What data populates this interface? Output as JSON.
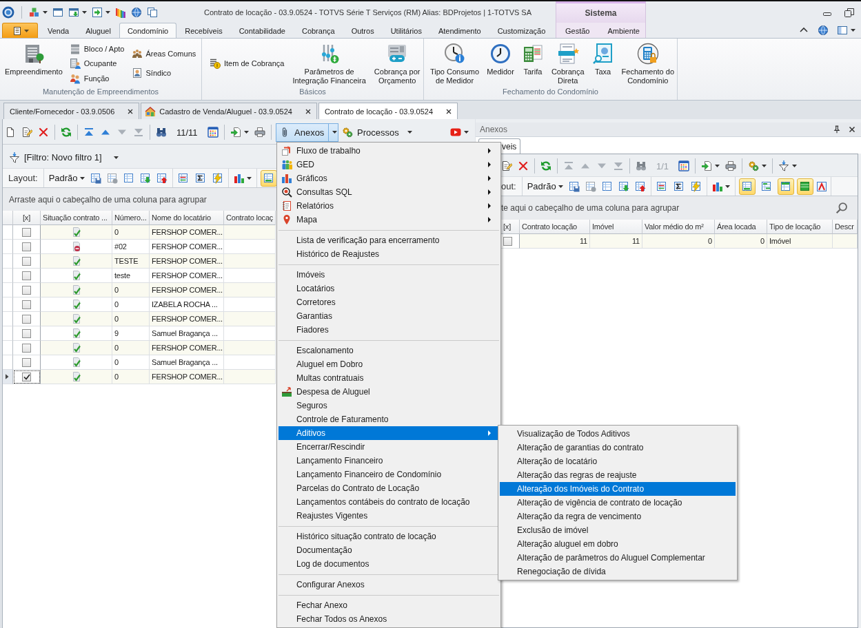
{
  "window": {
    "title": "Contrato de locação - 03.9.0524 - TOTVS Série T Serviços (RM) Alias: BDProjetos | 1-TOTVS SA"
  },
  "ribbon_tabs": [
    {
      "label": "Venda",
      "selected": false
    },
    {
      "label": "Aluguel",
      "selected": false
    },
    {
      "label": "Condomínio",
      "selected": true
    },
    {
      "label": "Recebíveis",
      "selected": false
    },
    {
      "label": "Contabilidade",
      "selected": false
    },
    {
      "label": "Cobrança",
      "selected": false
    },
    {
      "label": "Outros",
      "selected": false
    },
    {
      "label": "Utilitários",
      "selected": false
    },
    {
      "label": "Atendimento",
      "selected": false
    },
    {
      "label": "Customização",
      "selected": false
    }
  ],
  "context_tab_group": {
    "title": "Sistema",
    "tabs": [
      {
        "label": "Gestão",
        "selected": false
      },
      {
        "label": "Ambiente",
        "selected": false
      }
    ]
  },
  "ribbon_groups": [
    {
      "label": "Manutenção de Empreendimentos",
      "columns": [
        {
          "kind": "large",
          "lines": [
            "Empreendimento"
          ]
        },
        {
          "kind": "stack",
          "items": [
            "Bloco / Apto",
            "Ocupante",
            "Função"
          ]
        },
        {
          "kind": "stack",
          "items": [
            "Áreas Comuns",
            "Síndico"
          ]
        }
      ]
    },
    {
      "label": "Básicos",
      "columns": [
        {
          "kind": "stack",
          "items": [
            "Item de Cobrança"
          ]
        },
        {
          "kind": "large",
          "lines": [
            "Parâmetros de",
            "Integração Financeira"
          ]
        },
        {
          "kind": "large",
          "lines": [
            "Cobrança por",
            "Orçamento"
          ]
        }
      ]
    },
    {
      "label": "Fechamento do Condomínio",
      "columns": [
        {
          "kind": "large",
          "lines": [
            "Tipo Consumo",
            "de Medidor"
          ]
        },
        {
          "kind": "large",
          "lines": [
            "Medidor"
          ]
        },
        {
          "kind": "large",
          "lines": [
            "Tarifa"
          ]
        },
        {
          "kind": "large",
          "lines": [
            "Cobrança",
            "Direta"
          ]
        },
        {
          "kind": "large",
          "lines": [
            "Taxa"
          ]
        },
        {
          "kind": "large",
          "lines": [
            "Fechamento do",
            "Condomínio"
          ]
        }
      ]
    }
  ],
  "document_tabs": [
    {
      "label": "Cliente/Fornecedor - 03.9.0506",
      "selected": false
    },
    {
      "label": "Cadastro de Venda/Aluguel - 03.9.0524",
      "selected": false
    },
    {
      "label": "Contrato de locação - 03.9.0524",
      "selected": true
    }
  ],
  "toolbar": {
    "nav_buttons": [
      {
        "disabled": false
      },
      {
        "disabled": false
      },
      {
        "disabled": true
      },
      {
        "disabled": true
      }
    ],
    "record_counter": "11/11",
    "counter_disabled": false,
    "menu_buttons": [
      {
        "label": "Anexos",
        "pressed": true
      },
      {
        "label": "Processos",
        "pressed": false
      }
    ]
  },
  "filter": {
    "label": "[Filtro: Novo filtro 1]"
  },
  "layout_bar": {
    "label": "Layout:",
    "preset": "Padrão",
    "view_toggles": [
      {
        "on": true
      }
    ]
  },
  "group_panel": {
    "hint": "Arraste aqui o cabeçalho de uma coluna para agrupar"
  },
  "table": {
    "check_column": "[x]",
    "columns": [
      "Situação contrato ...",
      "Número...",
      "Nome do locatário",
      "Contrato locaç"
    ],
    "rows": [
      {
        "current": false,
        "checked": false,
        "blocked": false,
        "number": "0",
        "tenant": "FERSHOP COMER..."
      },
      {
        "current": false,
        "checked": false,
        "blocked": true,
        "number": "#02",
        "tenant": "FERSHOP COMER..."
      },
      {
        "current": false,
        "checked": false,
        "blocked": false,
        "number": "TESTE",
        "tenant": "FERSHOP COMER..."
      },
      {
        "current": false,
        "checked": false,
        "blocked": false,
        "number": "teste",
        "tenant": "FERSHOP COMER..."
      },
      {
        "current": false,
        "checked": false,
        "blocked": false,
        "number": "0",
        "tenant": "FERSHOP COMER..."
      },
      {
        "current": false,
        "checked": false,
        "blocked": false,
        "number": "0",
        "tenant": "IZABELA ROCHA ..."
      },
      {
        "current": false,
        "checked": false,
        "blocked": false,
        "number": "0",
        "tenant": "FERSHOP COMER..."
      },
      {
        "current": false,
        "checked": false,
        "blocked": false,
        "number": "9",
        "tenant": "Samuel Bragança ..."
      },
      {
        "current": false,
        "checked": false,
        "blocked": false,
        "number": "0",
        "tenant": "FERSHOP COMER..."
      },
      {
        "current": false,
        "checked": false,
        "blocked": false,
        "number": "0",
        "tenant": "Samuel Bragança ..."
      },
      {
        "current": true,
        "checked": true,
        "blocked": false,
        "number": "0",
        "tenant": "FERSHOP COMER..."
      }
    ]
  },
  "attachments_panel": {
    "title": "Anexos",
    "tabs": [
      {
        "label": "veis",
        "selected": true
      }
    ],
    "toolbar": {
      "nav_buttons": [
        {
          "disabled": true
        },
        {
          "disabled": true
        },
        {
          "disabled": true
        },
        {
          "disabled": true
        }
      ],
      "record_counter": "1/1",
      "counter_disabled": true
    },
    "layout_bar": {
      "label": "out:",
      "preset": "Padrão",
      "view_toggles": [
        {
          "on": true
        },
        {
          "on": false
        },
        {
          "on": true
        },
        {
          "on": true
        }
      ]
    },
    "group_panel": {
      "hint": "te aqui o cabeçalho de uma coluna para agrupar"
    },
    "table": {
      "check_column": "[x]",
      "columns": [
        "Contrato locação",
        "Imóvel",
        "Valor médio do m²",
        "Área locada",
        "Tipo de locação",
        "Descr"
      ],
      "rows": [
        {
          "checked": false,
          "cells": [
            "11",
            "11",
            "0",
            "0",
            "Imóvel"
          ]
        }
      ]
    }
  },
  "context_menu": {
    "groups": [
      [
        {
          "label": "Fluxo de trabalho",
          "submenu": true,
          "selected": false
        },
        {
          "label": "GED",
          "submenu": true,
          "selected": false
        },
        {
          "label": "Gráficos",
          "submenu": true,
          "selected": false
        },
        {
          "label": "Consultas SQL",
          "submenu": true,
          "selected": false
        },
        {
          "label": "Relatórios",
          "submenu": true,
          "selected": false
        },
        {
          "label": "Mapa",
          "submenu": true,
          "selected": false
        }
      ],
      [
        {
          "label": "Lista de verificação para encerramento",
          "submenu": false,
          "selected": false
        },
        {
          "label": "Histórico de Reajustes",
          "submenu": false,
          "selected": false
        }
      ],
      [
        {
          "label": "Imóveis",
          "submenu": false,
          "selected": false
        },
        {
          "label": "Locatários",
          "submenu": false,
          "selected": false
        },
        {
          "label": "Corretores",
          "submenu": false,
          "selected": false
        },
        {
          "label": "Garantias",
          "submenu": false,
          "selected": false
        },
        {
          "label": "Fiadores",
          "submenu": false,
          "selected": false
        }
      ],
      [
        {
          "label": "Escalonamento",
          "submenu": false,
          "selected": false
        },
        {
          "label": "Aluguel em Dobro",
          "submenu": false,
          "selected": false
        },
        {
          "label": "Multas contratuais",
          "submenu": false,
          "selected": false
        },
        {
          "label": "Despesa de Aluguel",
          "submenu": false,
          "selected": false
        },
        {
          "label": "Seguros",
          "submenu": false,
          "selected": false
        },
        {
          "label": "Controle de Faturamento",
          "submenu": false,
          "selected": false
        },
        {
          "label": "Aditivos",
          "submenu": true,
          "selected": true
        },
        {
          "label": "Encerrar/Rescindir",
          "submenu": false,
          "selected": false
        },
        {
          "label": "Lançamento Financeiro",
          "submenu": false,
          "selected": false
        },
        {
          "label": "Lançamento Financeiro de Condomínio",
          "submenu": false,
          "selected": false
        },
        {
          "label": "Parcelas do Contrato de Locação",
          "submenu": false,
          "selected": false
        },
        {
          "label": "Lançamentos contábeis do contrato de locação",
          "submenu": false,
          "selected": false
        },
        {
          "label": "Reajustes Vigentes",
          "submenu": false,
          "selected": false
        }
      ],
      [
        {
          "label": "Histórico situação contrato de locação",
          "submenu": false,
          "selected": false
        },
        {
          "label": "Documentação",
          "submenu": false,
          "selected": false
        },
        {
          "label": "Log de documentos",
          "submenu": false,
          "selected": false
        }
      ],
      [
        {
          "label": "Configurar Anexos",
          "submenu": false,
          "selected": false
        }
      ],
      [
        {
          "label": "Fechar Anexo",
          "submenu": false,
          "selected": false
        },
        {
          "label": "Fechar Todos os Anexos",
          "submenu": false,
          "selected": false
        }
      ]
    ]
  },
  "submenu": {
    "items": [
      {
        "label": "Visualização de Todos Aditivos",
        "selected": false
      },
      {
        "label": "Alteração de garantias do contrato",
        "selected": false
      },
      {
        "label": "Alteração de locatário",
        "selected": false
      },
      {
        "label": "Alteração das regras de reajuste",
        "selected": false
      },
      {
        "label": "Alteração dos Imóveis do Contrato",
        "selected": true
      },
      {
        "label": "Alteração de vigência de contrato de locação",
        "selected": false
      },
      {
        "label": "Alteração da regra de vencimento",
        "selected": false
      },
      {
        "label": "Exclusão de imóvel",
        "selected": false
      },
      {
        "label": "Alteração aluguel em dobro",
        "selected": false
      },
      {
        "label": "Alteração de parâmetros do Aluguel Complementar",
        "selected": false
      },
      {
        "label": "Renegociação de dívida",
        "selected": false
      }
    ]
  }
}
